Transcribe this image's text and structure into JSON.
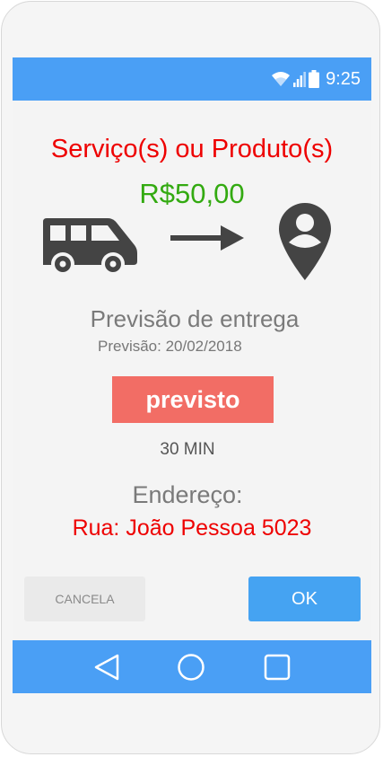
{
  "status_bar": {
    "time": "9:25",
    "icons": [
      "wifi-icon",
      "signal-icon",
      "battery-icon"
    ]
  },
  "order": {
    "title": "Serviço(s) ou Produto(s)",
    "price": "R$50,00",
    "icons": [
      "van-icon",
      "arrow-right-icon",
      "location-pin-icon"
    ]
  },
  "delivery": {
    "heading": "Previsão de entrega",
    "date": "Previsão: 20/02/2018",
    "status": "previsto",
    "eta": "30 MIN"
  },
  "address": {
    "label": "Endereço:",
    "value": "Rua: João Pessoa 5023"
  },
  "actions": {
    "cancel_label": "CANCELA",
    "ok_label": "OK"
  },
  "nav_bar": {
    "icons": [
      "back-icon",
      "home-icon",
      "recents-icon"
    ]
  },
  "colors": {
    "bar": "#4a9ff5",
    "title": "#ee0000",
    "price": "#33aa11",
    "status_pill": "#f26d65",
    "ok_button": "#45a3f2"
  }
}
